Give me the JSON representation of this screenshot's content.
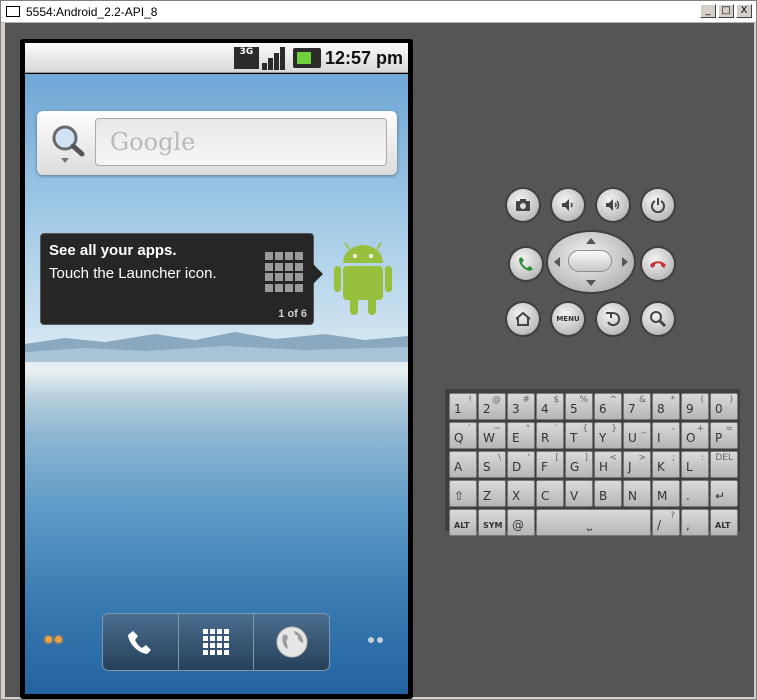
{
  "window": {
    "title": "5554:Android_2.2-API_8",
    "min_label": "_",
    "max_label": "□",
    "close_label": "X"
  },
  "status_bar": {
    "network_label": "3G",
    "time": "12:57 pm"
  },
  "search_widget": {
    "placeholder": "Google"
  },
  "tip": {
    "title": "See all your apps.",
    "body": "Touch the Launcher icon.",
    "page_indicator": "1 of 6"
  },
  "hardware_buttons": {
    "menu_label": "MENU"
  },
  "keyboard": {
    "row1": [
      {
        "main": "1",
        "alt": "!"
      },
      {
        "main": "2",
        "alt": "@"
      },
      {
        "main": "3",
        "alt": "#"
      },
      {
        "main": "4",
        "alt": "$"
      },
      {
        "main": "5",
        "alt": "%"
      },
      {
        "main": "6",
        "alt": "^"
      },
      {
        "main": "7",
        "alt": "&"
      },
      {
        "main": "8",
        "alt": "*"
      },
      {
        "main": "9",
        "alt": "("
      },
      {
        "main": "0",
        "alt": ")"
      }
    ],
    "row2": [
      {
        "main": "Q",
        "alt": "`"
      },
      {
        "main": "W",
        "alt": "~"
      },
      {
        "main": "E",
        "alt": "\""
      },
      {
        "main": "R",
        "alt": "`"
      },
      {
        "main": "T",
        "alt": "{"
      },
      {
        "main": "Y",
        "alt": "}"
      },
      {
        "main": "U",
        "alt": "_"
      },
      {
        "main": "I",
        "alt": "-"
      },
      {
        "main": "O",
        "alt": "+"
      },
      {
        "main": "P",
        "alt": "="
      }
    ],
    "row3": [
      {
        "main": "A",
        "alt": ""
      },
      {
        "main": "S",
        "alt": "\\"
      },
      {
        "main": "D",
        "alt": "'"
      },
      {
        "main": "F",
        "alt": "["
      },
      {
        "main": "G",
        "alt": "]"
      },
      {
        "main": "H",
        "alt": "<"
      },
      {
        "main": "J",
        "alt": ">"
      },
      {
        "main": "K",
        "alt": ";"
      },
      {
        "main": "L",
        "alt": ":"
      },
      {
        "main": "",
        "alt": "DEL"
      }
    ],
    "row4": [
      {
        "main": "⇧",
        "alt": ""
      },
      {
        "main": "Z",
        "alt": ""
      },
      {
        "main": "X",
        "alt": ""
      },
      {
        "main": "C",
        "alt": ""
      },
      {
        "main": "V",
        "alt": ""
      },
      {
        "main": "B",
        "alt": ""
      },
      {
        "main": "N",
        "alt": ""
      },
      {
        "main": "M",
        "alt": ""
      },
      {
        "main": ".",
        "alt": ""
      },
      {
        "main": "↵",
        "alt": ""
      }
    ],
    "row5": {
      "alt_left": "ALT",
      "sym": "SYM",
      "at": "@",
      "space": "⎵",
      "slash": "/",
      "slash_alt": "?",
      "comma": ",",
      "alt_right": "ALT"
    }
  }
}
